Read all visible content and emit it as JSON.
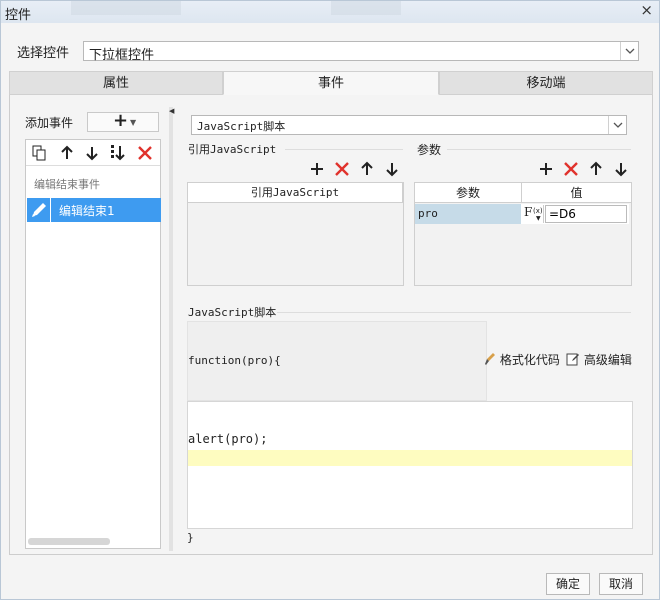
{
  "window": {
    "title": "控件",
    "close_glyph": "×"
  },
  "control_select": {
    "label": "选择控件",
    "value": "下拉框控件"
  },
  "tabs": [
    {
      "label": "属性"
    },
    {
      "label": "事件"
    },
    {
      "label": "移动端"
    }
  ],
  "events_panel": {
    "add_event_label": "添加事件",
    "event_type": "编辑结束事件",
    "items": [
      {
        "label": "编辑结束1"
      }
    ]
  },
  "script_type": {
    "value": "JavaScript脚本"
  },
  "ref_js": {
    "title": "引用JavaScript",
    "column": "引用JavaScript"
  },
  "params": {
    "title": "参数",
    "columns": [
      "参数",
      "值"
    ],
    "rows": [
      {
        "name": "pro",
        "value": "=D6"
      }
    ]
  },
  "js_script": {
    "title": "JavaScript脚本",
    "header": "function(pro){",
    "body_line": "alert(pro);",
    "footer": "}",
    "format_label": "格式化代码",
    "advanced_label": "高级编辑"
  },
  "footer": {
    "ok_label": "确定",
    "cancel_label": "取消"
  },
  "colors": {
    "accent": "#3e9bf0",
    "delete": "#e0322c",
    "highlight": "#fefcc0",
    "param_cell": "#c6dbe8"
  }
}
